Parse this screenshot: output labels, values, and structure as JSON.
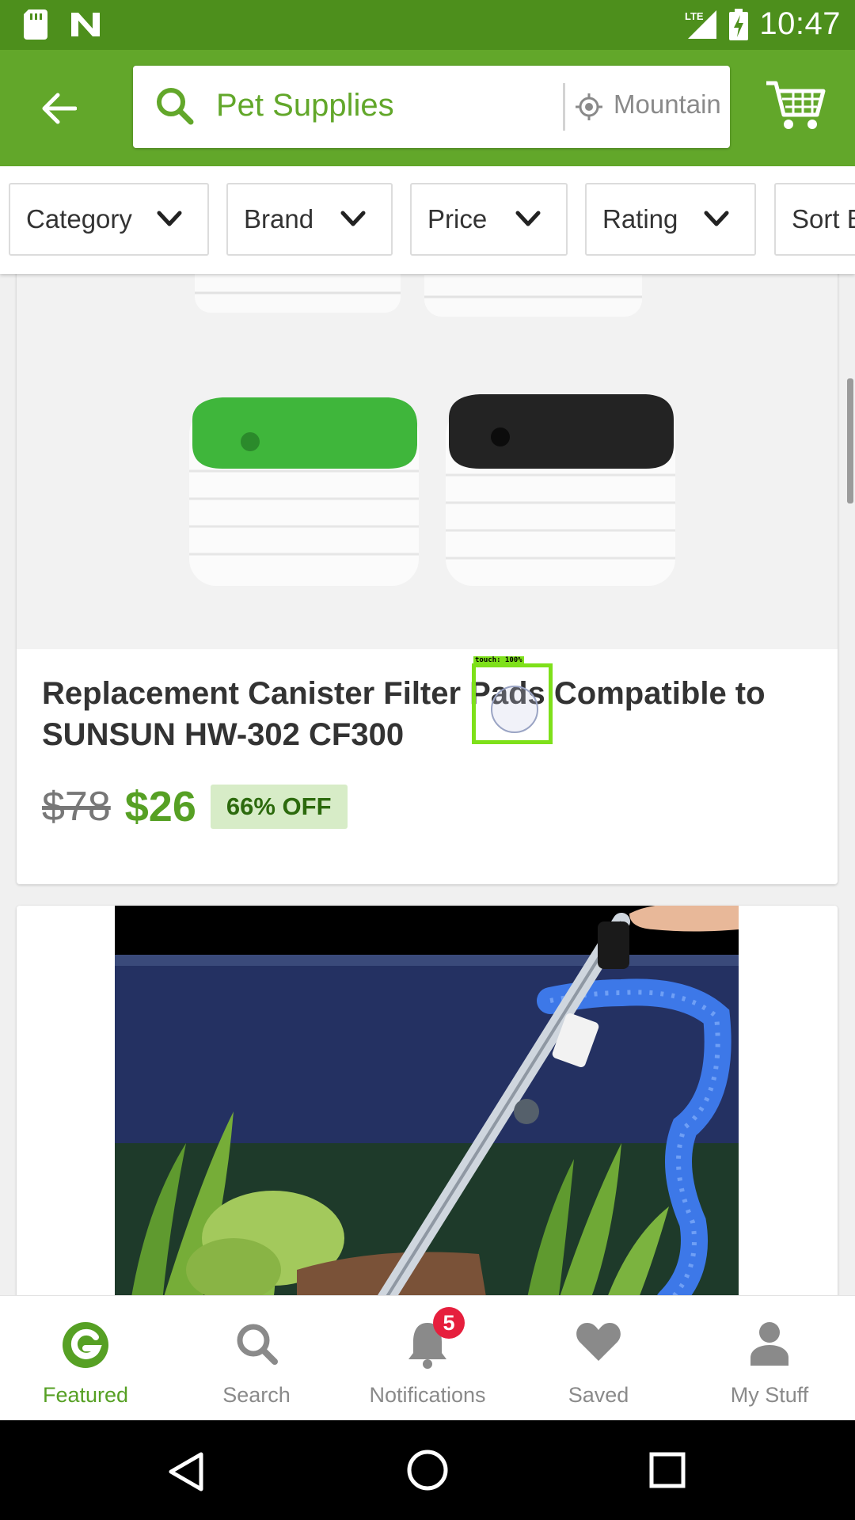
{
  "status_bar": {
    "time": "10:47",
    "network": "LTE",
    "icons": [
      "sd-card-icon",
      "n-notification-icon",
      "signal-icon",
      "battery-charging-icon"
    ]
  },
  "header": {
    "back_icon": "arrow-left-icon",
    "search_query": "Pet Supplies",
    "location_text": "Mountain",
    "cart_icon": "cart-icon"
  },
  "filters": [
    {
      "label": "Category"
    },
    {
      "label": "Brand"
    },
    {
      "label": "Price"
    },
    {
      "label": "Rating"
    },
    {
      "label": "Sort B"
    }
  ],
  "products": [
    {
      "title": "Replacement Canister Filter Pads Compatible to SUNSUN HW-302 CF300",
      "old_price": "$78",
      "new_price": "$26",
      "discount": "66% OFF"
    }
  ],
  "touch_overlay": {
    "label": "touch: 100%"
  },
  "bottom_nav": {
    "items": [
      {
        "label": "Featured",
        "icon": "groupon-g-icon",
        "active": true
      },
      {
        "label": "Search",
        "icon": "search-icon",
        "active": false
      },
      {
        "label": "Notifications",
        "icon": "bell-icon",
        "active": false
      },
      {
        "label": "Saved",
        "icon": "heart-icon",
        "active": false
      },
      {
        "label": "My Stuff",
        "icon": "person-icon",
        "active": false
      }
    ],
    "notification_count": "5"
  },
  "colors": {
    "brand_green": "#62a72a",
    "status_green": "#4d8f1c",
    "price_green": "#56a024",
    "badge_red": "#e61f3d"
  }
}
